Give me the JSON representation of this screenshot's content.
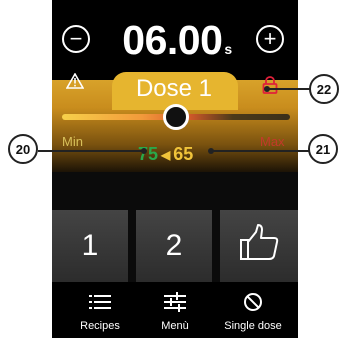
{
  "timer": {
    "minus_label": "−",
    "plus_label": "+",
    "value": "06.00",
    "unit": "s"
  },
  "dose_panel": {
    "warning_icon": "warning-triangle-icon",
    "title": "Dose 1",
    "lock_icon": "lock-icon",
    "slider": {
      "min_label": "Min",
      "max_label": "Max",
      "value_fraction": 0.5
    },
    "previous_value": "75",
    "current_value": "65"
  },
  "keys": {
    "key1_label": "1",
    "key2_label": "2",
    "confirm_icon": "thumbs-up-icon"
  },
  "bottom_nav": {
    "recipes_label": "Recipes",
    "menu_label": "Menù",
    "single_dose_label": "Single dose"
  },
  "callouts": {
    "c20": "20",
    "c21": "21",
    "c22": "22"
  },
  "colors": {
    "panel_gold": "#e6b52f",
    "value_green": "#2aa84a",
    "value_yellow": "#f0c33a",
    "lock_red": "#e0203a"
  }
}
